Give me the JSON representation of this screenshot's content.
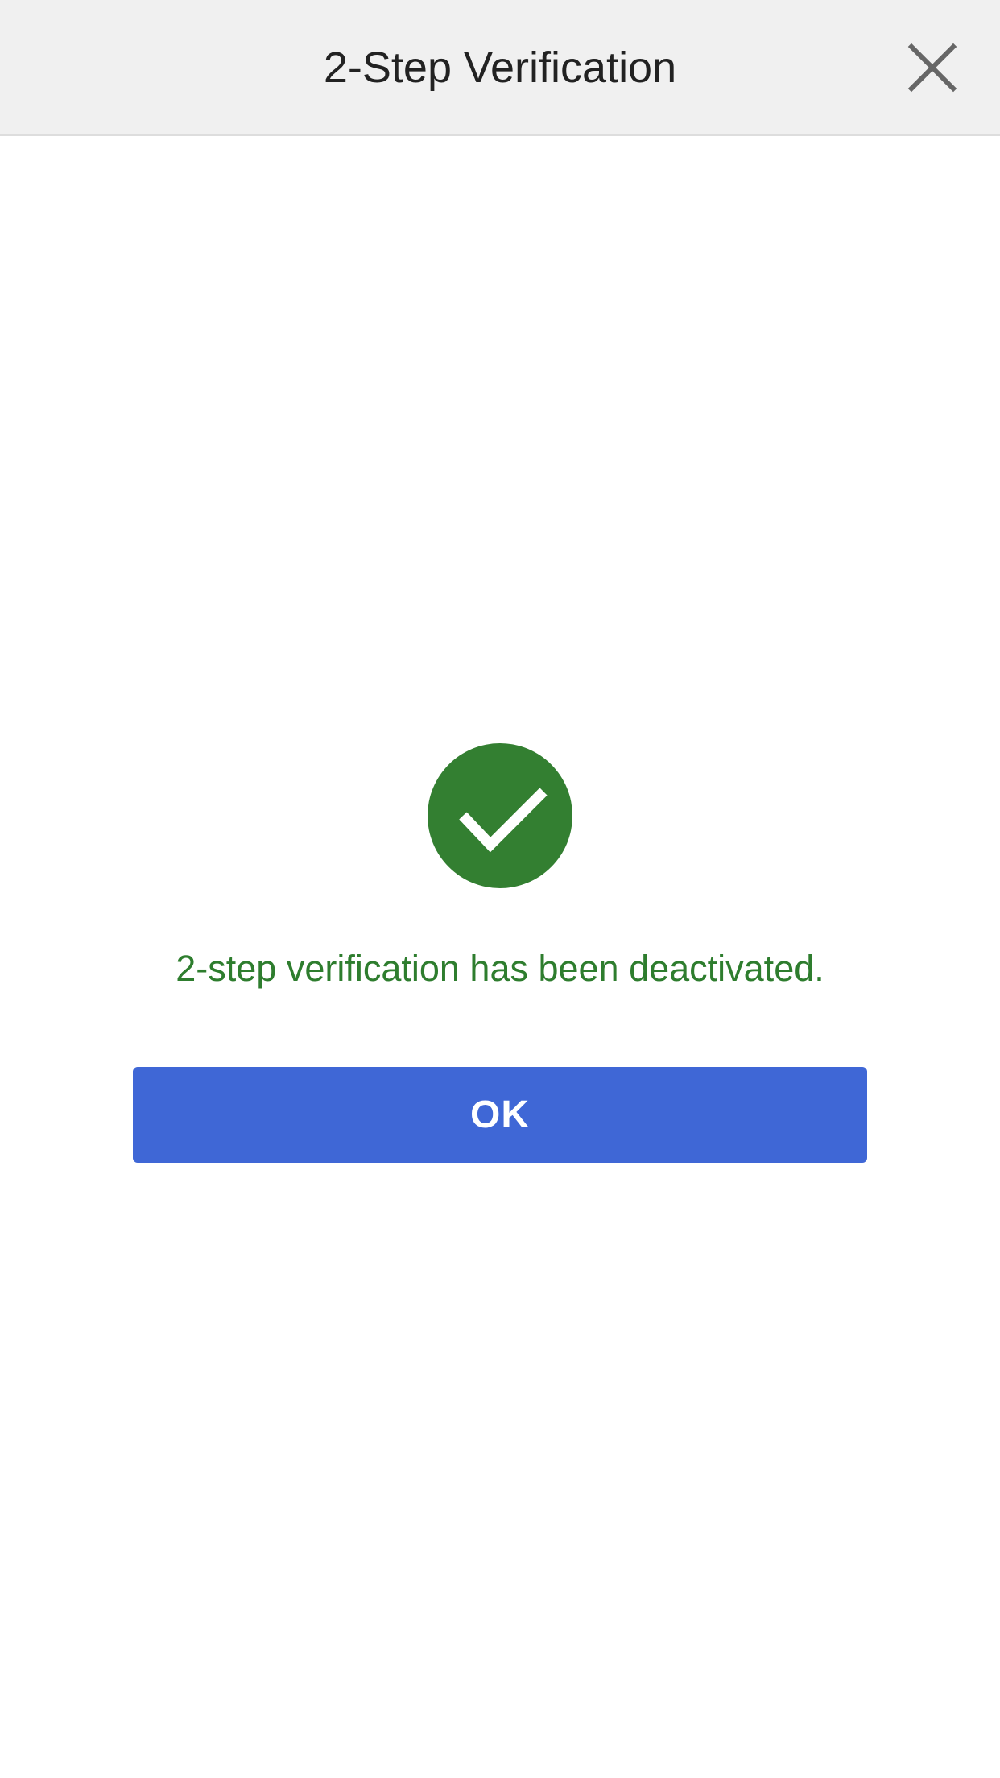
{
  "header": {
    "title": "2-Step Verification",
    "close_icon": "close-icon",
    "background_color": "#f0f0f0"
  },
  "main": {
    "status_icon": "check-circle-icon",
    "status_color": "#337f31",
    "message": "2-step verification has been deactivated.",
    "message_color": "#2e7d2e",
    "ok_label": "OK",
    "ok_color": "#3f67d6"
  }
}
